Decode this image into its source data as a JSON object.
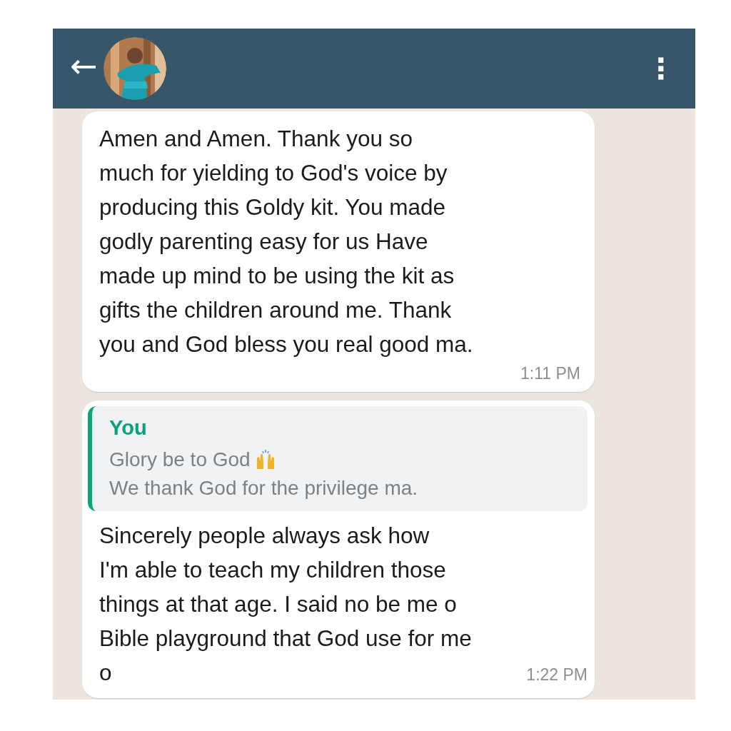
{
  "header": {
    "back": "←",
    "menu": "⋮"
  },
  "messages": [
    {
      "kind": "plain",
      "text": "Amen and Amen.  Thank you so\nmuch for yielding to God's voice by\nproducing this Goldy kit. You made\ngodly parenting easy for us Have\nmade up mind to be using the kit as\ngifts the children around me.  Thank\nyou and God bless you real good ma.",
      "time": "1:11 PM"
    },
    {
      "kind": "reply",
      "quote": {
        "author": "You",
        "lines": [
          "Glory be to God",
          "We thank God for the privilege ma."
        ]
      },
      "text": "Sincerely people always ask how\nI'm able to teach my children those\nthings at that age. I said no be me o\nBible playground that God use for me\no",
      "time": "1:22 PM"
    }
  ]
}
